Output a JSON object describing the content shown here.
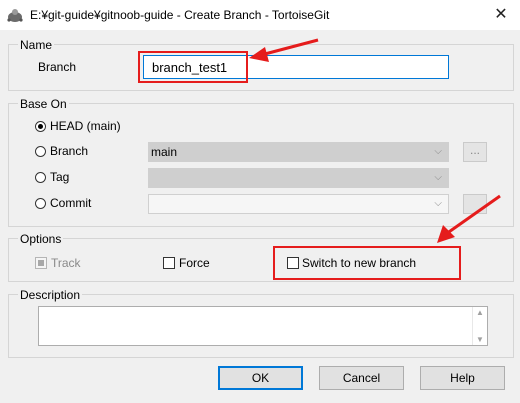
{
  "window": {
    "title": "E:¥git-guide¥gitnoob-guide - Create Branch - TortoiseGit"
  },
  "name_group": {
    "label": "Name",
    "branch_label": "Branch",
    "branch_value": "branch_test1"
  },
  "base_on": {
    "label": "Base On",
    "options": [
      {
        "label": "HEAD (main)",
        "selected": true
      },
      {
        "label": "Branch",
        "combo_value": "main"
      },
      {
        "label": "Tag",
        "combo_value": ""
      },
      {
        "label": "Commit",
        "combo_value": ""
      }
    ],
    "more_button": "..."
  },
  "options_group": {
    "label": "Options",
    "track": "Track",
    "force": "Force",
    "switch": "Switch to new branch"
  },
  "description": {
    "label": "Description",
    "value": ""
  },
  "buttons": {
    "ok": "OK",
    "cancel": "Cancel",
    "help": "Help"
  },
  "annotation_color": "#e51c1c"
}
